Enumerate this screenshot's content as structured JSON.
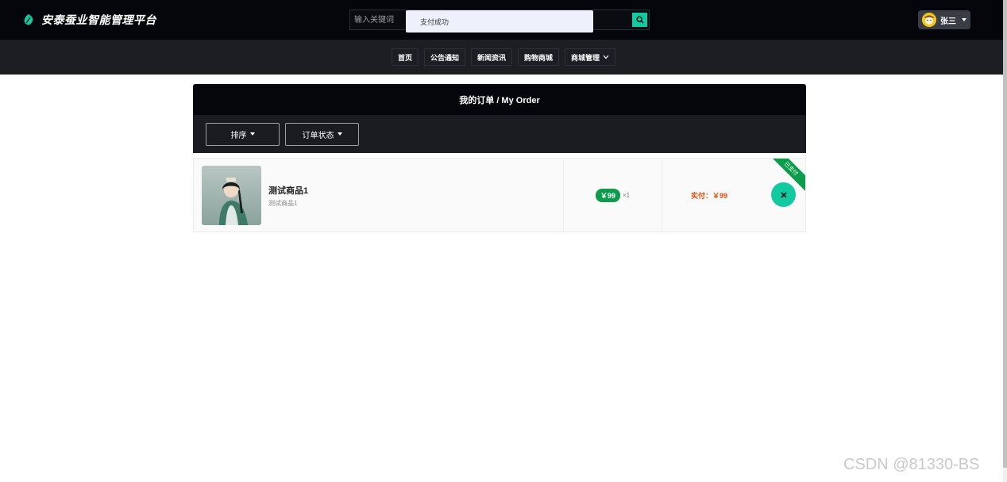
{
  "header": {
    "brand_title": "安泰蚕业智能管理平台",
    "search_placeholder": "输入关键词",
    "toast": "支付成功",
    "user_name": "张三"
  },
  "nav": {
    "items": [
      {
        "label": "首页"
      },
      {
        "label": "公告通知"
      },
      {
        "label": "新闻资讯"
      },
      {
        "label": "购物商城"
      },
      {
        "label": "商城管理"
      }
    ]
  },
  "orders_panel": {
    "title": "我的订单 / My Order",
    "sort_label": "排序",
    "status_label": "订单状态"
  },
  "order": {
    "product_name": "测试商品1",
    "product_desc": "测试商品1",
    "price": "￥99",
    "quantity": "×1",
    "paid_label": "实付：￥99",
    "status_ribbon": "已支付"
  },
  "watermark": "CSDN @81330-BS",
  "colors": {
    "accent": "#13c9a0",
    "badge_green": "#0d9c4b",
    "paid_orange": "#e34d0b",
    "header_bg": "#05060b",
    "nav_bg": "#1c1e24"
  }
}
